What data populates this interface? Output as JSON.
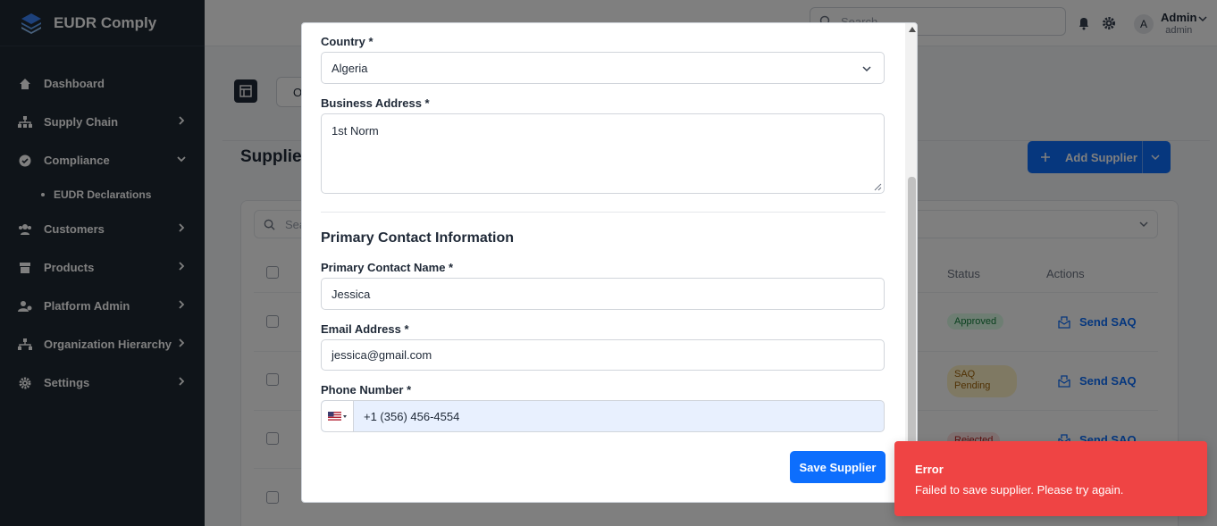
{
  "brand": {
    "name": "EUDR Comply"
  },
  "sidebar": {
    "items": [
      {
        "label": "Dashboard",
        "icon": "home-icon"
      },
      {
        "label": "Supply Chain",
        "icon": "sitemap-icon"
      },
      {
        "label": "Compliance",
        "icon": "check-circle-icon"
      },
      {
        "label": "EUDR Declarations",
        "icon": "dot-icon"
      },
      {
        "label": "Customers",
        "icon": "users-icon"
      },
      {
        "label": "Products",
        "icon": "box-icon"
      },
      {
        "label": "Platform Admin",
        "icon": "admin-icon"
      },
      {
        "label": "Organization Hierarchy",
        "icon": "hierarchy-icon"
      },
      {
        "label": "Settings",
        "icon": "gear-icon"
      }
    ]
  },
  "header": {
    "search_placeholder": "Search...",
    "user_initial": "A",
    "user_name": "Admin",
    "user_role": "admin"
  },
  "main": {
    "tab_label": "O",
    "page_title": "Supplier",
    "add_button": "Add Supplier",
    "table_search_placeholder": "Sea",
    "columns": {
      "status": "Status",
      "actions": "Actions"
    },
    "rows": [
      {
        "status": "Approved",
        "action": "Send SAQ"
      },
      {
        "status": "SAQ Pending",
        "action": "Send SAQ"
      },
      {
        "status": "Rejected",
        "action": "Send SAQ"
      }
    ]
  },
  "modal": {
    "country": {
      "label": "Country *",
      "value": "Algeria"
    },
    "address": {
      "label": "Business Address *",
      "value": "1st Norm"
    },
    "section_title": "Primary Contact Information",
    "contact_name": {
      "label": "Primary Contact Name *",
      "value": "Jessica"
    },
    "email": {
      "label": "Email Address *",
      "value": "jessica@gmail.com"
    },
    "phone": {
      "label": "Phone Number *",
      "value": "+1 (356) 456-4554"
    },
    "save_button": "Save Supplier"
  },
  "toast": {
    "title": "Error",
    "message": "Failed to save supplier. Please try again.",
    "color": "#ef4444"
  }
}
